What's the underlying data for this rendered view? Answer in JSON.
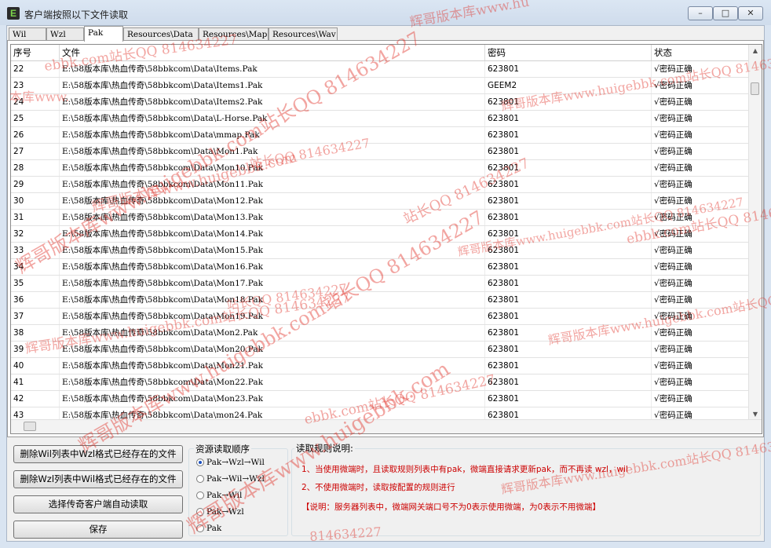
{
  "window": {
    "icon": "E",
    "title": "客户端按照以下文件读取",
    "controls": {
      "minimize": "–",
      "maximize": "□",
      "close": "✕"
    }
  },
  "tabs": [
    {
      "label": "Wil",
      "active": false
    },
    {
      "label": "Wzl",
      "active": false
    },
    {
      "label": "Pak",
      "active": true
    },
    {
      "label": "Resources\\Data",
      "active": false
    },
    {
      "label": "Resources\\Map",
      "active": false
    },
    {
      "label": "Resources\\Wav",
      "active": false
    }
  ],
  "table": {
    "columns": [
      "序号",
      "文件",
      "密码",
      "状态"
    ],
    "rows": [
      {
        "no": "22",
        "file": "E:\\58版本库\\热血传奇\\58bbkcom\\Data\\Items.Pak",
        "password": "623801",
        "status": "√密码正确"
      },
      {
        "no": "23",
        "file": "E:\\58版本库\\热血传奇\\58bbkcom\\Data\\Items1.Pak",
        "password": "GEEM2",
        "status": "√密码正确"
      },
      {
        "no": "24",
        "file": "E:\\58版本库\\热血传奇\\58bbkcom\\Data\\Items2.Pak",
        "password": "623801",
        "status": "√密码正确"
      },
      {
        "no": "25",
        "file": "E:\\58版本库\\热血传奇\\58bbkcom\\Data\\L-Horse.Pak",
        "password": "623801",
        "status": "√密码正确"
      },
      {
        "no": "26",
        "file": "E:\\58版本库\\热血传奇\\58bbkcom\\Data\\mmap.Pak",
        "password": "623801",
        "status": "√密码正确"
      },
      {
        "no": "27",
        "file": "E:\\58版本库\\热血传奇\\58bbkcom\\Data\\Mon1.Pak",
        "password": "623801",
        "status": "√密码正确"
      },
      {
        "no": "28",
        "file": "E:\\58版本库\\热血传奇\\58bbkcom\\Data\\Mon10.Pak",
        "password": "623801",
        "status": "√密码正确"
      },
      {
        "no": "29",
        "file": "E:\\58版本库\\热血传奇\\58bbkcom\\Data\\Mon11.Pak",
        "password": "623801",
        "status": "√密码正确"
      },
      {
        "no": "30",
        "file": "E:\\58版本库\\热血传奇\\58bbkcom\\Data\\Mon12.Pak",
        "password": "623801",
        "status": "√密码正确"
      },
      {
        "no": "31",
        "file": "E:\\58版本库\\热血传奇\\58bbkcom\\Data\\Mon13.Pak",
        "password": "623801",
        "status": "√密码正确"
      },
      {
        "no": "32",
        "file": "E:\\58版本库\\热血传奇\\58bbkcom\\Data\\Mon14.Pak",
        "password": "623801",
        "status": "√密码正确"
      },
      {
        "no": "33",
        "file": "E:\\58版本库\\热血传奇\\58bbkcom\\Data\\Mon15.Pak",
        "password": "623801",
        "status": "√密码正确"
      },
      {
        "no": "34",
        "file": "E:\\58版本库\\热血传奇\\58bbkcom\\Data\\Mon16.Pak",
        "password": "623801",
        "status": "√密码正确"
      },
      {
        "no": "35",
        "file": "E:\\58版本库\\热血传奇\\58bbkcom\\Data\\Mon17.Pak",
        "password": "623801",
        "status": "√密码正确"
      },
      {
        "no": "36",
        "file": "E:\\58版本库\\热血传奇\\58bbkcom\\Data\\Mon18.Pak",
        "password": "623801",
        "status": "√密码正确"
      },
      {
        "no": "37",
        "file": "E:\\58版本库\\热血传奇\\58bbkcom\\Data\\Mon19.Pak",
        "password": "623801",
        "status": "√密码正确"
      },
      {
        "no": "38",
        "file": "E:\\58版本库\\热血传奇\\58bbkcom\\Data\\Mon2.Pak",
        "password": "623801",
        "status": "√密码正确"
      },
      {
        "no": "39",
        "file": "E:\\58版本库\\热血传奇\\58bbkcom\\Data\\Mon20.Pak",
        "password": "623801",
        "status": "√密码正确"
      },
      {
        "no": "40",
        "file": "E:\\58版本库\\热血传奇\\58bbkcom\\Data\\Mon21.Pak",
        "password": "623801",
        "status": "√密码正确"
      },
      {
        "no": "41",
        "file": "E:\\58版本库\\热血传奇\\58bbkcom\\Data\\Mon22.Pak",
        "password": "623801",
        "status": "√密码正确"
      },
      {
        "no": "42",
        "file": "E:\\58版本库\\热血传奇\\58bbkcom\\Data\\Mon23.Pak",
        "password": "623801",
        "status": "√密码正确"
      },
      {
        "no": "43",
        "file": "E:\\58版本库\\热血传奇\\58bbkcom\\Data\\mon24.Pak",
        "password": "623801",
        "status": "√密码正确"
      }
    ]
  },
  "buttons": {
    "delete_wil": "删除Wil列表中Wzl格式已经存在的文件",
    "delete_wzl": "删除Wzl列表中Wil格式已经存在的文件",
    "select_client": "选择传奇客户端自动读取",
    "save": "保存"
  },
  "read_order": {
    "title": "资源读取顺序",
    "selected": 0,
    "options": [
      "Pak→Wzl→Wil",
      "Pak→Wil→Wzl",
      "Pak→Wil",
      "Pak→Wzl",
      "Pak"
    ]
  },
  "rules": {
    "title": "读取规则说明:",
    "line1": "1、当使用微端时，且读取规则列表中有pak，微端直接请求更新pak，而不再读 wzl，wil",
    "line2": "2、不使用微端时，读取按配置的规则进行",
    "note": "【说明：服务器列表中，微端网关端口号不为0表示使用微端，为0表示不用微端】"
  },
  "watermarks": {
    "site": "辉哥版本库www.huigebbk.com站长QQ 814634227",
    "brand": "辉哥版本库www.huigebbk.com",
    "qq": "站长QQ 814634227",
    "qq_number": "814634227",
    "short": "辉哥版本库",
    "fragment": "辉哥版本库www.hu",
    "tail": "ebbk.com站长QQ 814634227",
    "corner": "本库www."
  },
  "colors": {
    "rules_text": "#cc0000",
    "watermark": "#e1281e",
    "window_frame": "#d9e4f1"
  }
}
